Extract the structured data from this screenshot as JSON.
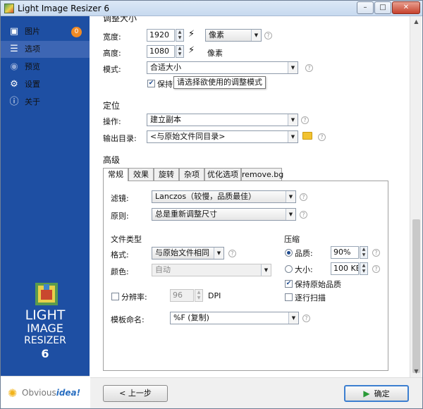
{
  "window": {
    "title": "Light Image Resizer 6",
    "controls": {
      "minimize": "–",
      "maximize": "□",
      "close": "✕"
    }
  },
  "sidebar": {
    "items": [
      {
        "label": "图片",
        "icon": "images-icon",
        "badge": "0",
        "state": "normal"
      },
      {
        "label": "选项",
        "icon": "sliders-icon",
        "state": "active"
      },
      {
        "label": "预览",
        "icon": "eye-icon",
        "state": "disabled"
      },
      {
        "label": "设置",
        "icon": "gear-icon",
        "state": "normal"
      },
      {
        "label": "关于",
        "icon": "info-icon",
        "state": "normal"
      }
    ],
    "logo": {
      "line1": "LIGHT",
      "line2": "IMAGE",
      "line3": "RESIZER",
      "line4": "6"
    },
    "brand": {
      "prefix": "Obvious",
      "suffix": "idea!"
    }
  },
  "resize": {
    "section_label": "调整大小",
    "width_label": "宽度:",
    "width_value": "1920",
    "height_label": "高度:",
    "height_value": "1080",
    "unit_selected": "像素",
    "unit_label": "像素",
    "mode_label": "模式:",
    "mode_value": "合适大小",
    "keep_ratio_label": "保持宽",
    "keep_ratio_checked": true,
    "tooltip": "请选择欲使用的调整模式"
  },
  "target": {
    "section_label": "定位",
    "action_label": "操作:",
    "action_value": "建立副本",
    "output_label": "输出目录:",
    "output_value": "<与原始文件同目录>"
  },
  "advanced": {
    "section_label": "高级",
    "tabs": [
      "常规",
      "效果",
      "旋转",
      "杂项",
      "优化选项",
      "remove.bg"
    ],
    "active_tab": 0,
    "filter_label": "滤镜:",
    "filter_value": "Lanczos（较慢，品质最佳）",
    "rule_label": "原则:",
    "rule_value": "总是重新调整尺寸",
    "filetype_label": "文件类型",
    "format_label": "格式:",
    "format_value": "与原始文件相同",
    "color_label": "颜色:",
    "color_value": "自动",
    "resolution_label": "分辨率:",
    "resolution_checked": false,
    "resolution_value": "96",
    "resolution_unit": "DPI",
    "compression_label": "压缩",
    "quality_label": "品质:",
    "quality_value": "90%",
    "quality_selected": true,
    "size_label": "大小:",
    "size_value": "100 KB",
    "keep_quality_label": "保持原始品质",
    "keep_quality_checked": true,
    "progressive_label": "逐行扫描",
    "progressive_checked": false,
    "template_label": "模板命名:",
    "template_value": "%F (复制)"
  },
  "footer": {
    "back_label": "< 上一步",
    "ok_label": "确定"
  },
  "colors": {
    "sidebar_bg": "#1e4fa3",
    "sidebar_active": "#3d66b4",
    "badge": "#f08a24",
    "primary_border": "#3c7fd0",
    "play_icon": "#2a9a37"
  }
}
